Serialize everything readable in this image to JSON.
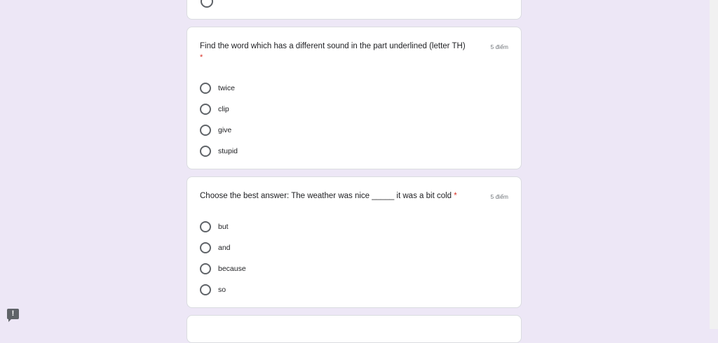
{
  "questions": [
    {
      "title": "Find the word which has a different sound in the part underlined (letter TH)",
      "required_mark": "*",
      "points": "5 điểm",
      "options": [
        "twice",
        "clip",
        "give",
        "stupid"
      ]
    },
    {
      "title": "Choose the best answer: The weather was nice _____ it was a bit cold",
      "required_mark": "*",
      "points": "5 điểm",
      "options": [
        "but",
        "and",
        "because",
        "so"
      ]
    }
  ],
  "feedback": {
    "icon": "feedback-icon",
    "glyph": "!"
  }
}
